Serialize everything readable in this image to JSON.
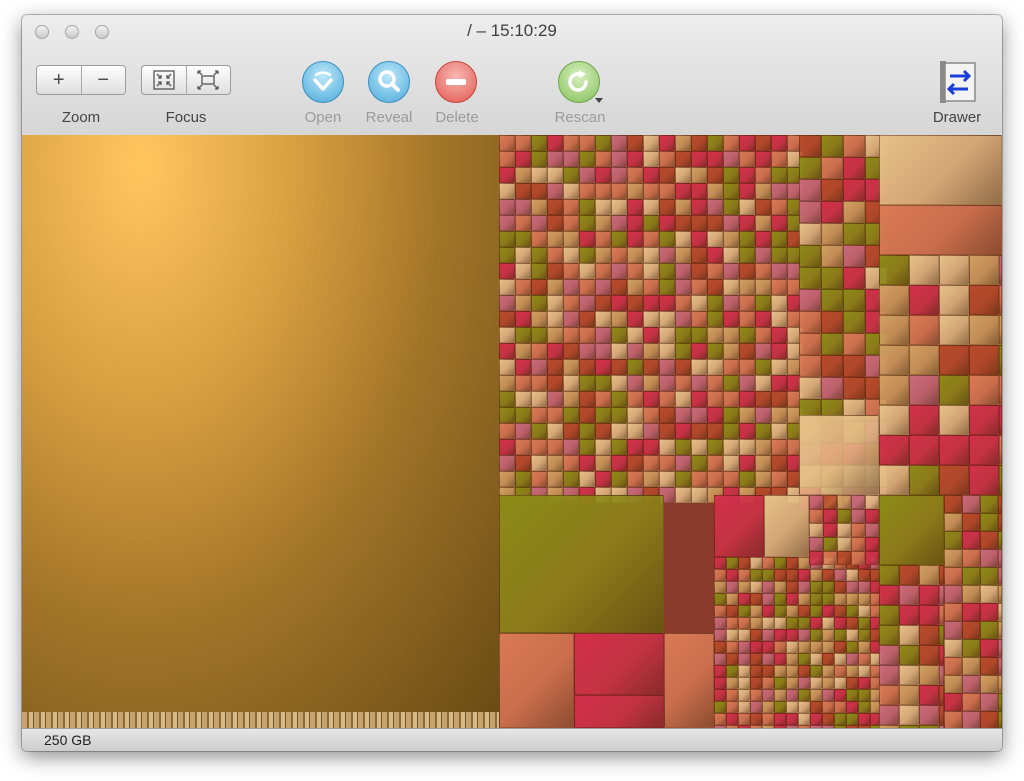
{
  "window": {
    "title": "/ – 15:10:29"
  },
  "toolbar": {
    "zoom_in": "+",
    "zoom_out": "−",
    "zoom_label": "Zoom",
    "focus_label": "Focus",
    "open_label": "Open",
    "reveal_label": "Reveal",
    "delete_label": "Delete",
    "rescan_label": "Rescan",
    "drawer_label": "Drawer",
    "icons": {
      "focus_in": "focus-in-icon",
      "focus_out": "focus-out-icon",
      "open": "open-icon",
      "reveal": "magnifier-icon",
      "delete": "minus-circle-icon",
      "rescan": "refresh-icon",
      "drawer": "drawer-icon"
    }
  },
  "colors": {
    "big_file": "#fbbf55",
    "olive": "#8c8a16",
    "red": "#d2304a",
    "tan": "#e6c088",
    "salmon": "#d97a55"
  },
  "status": {
    "total_size": "250 GB"
  }
}
